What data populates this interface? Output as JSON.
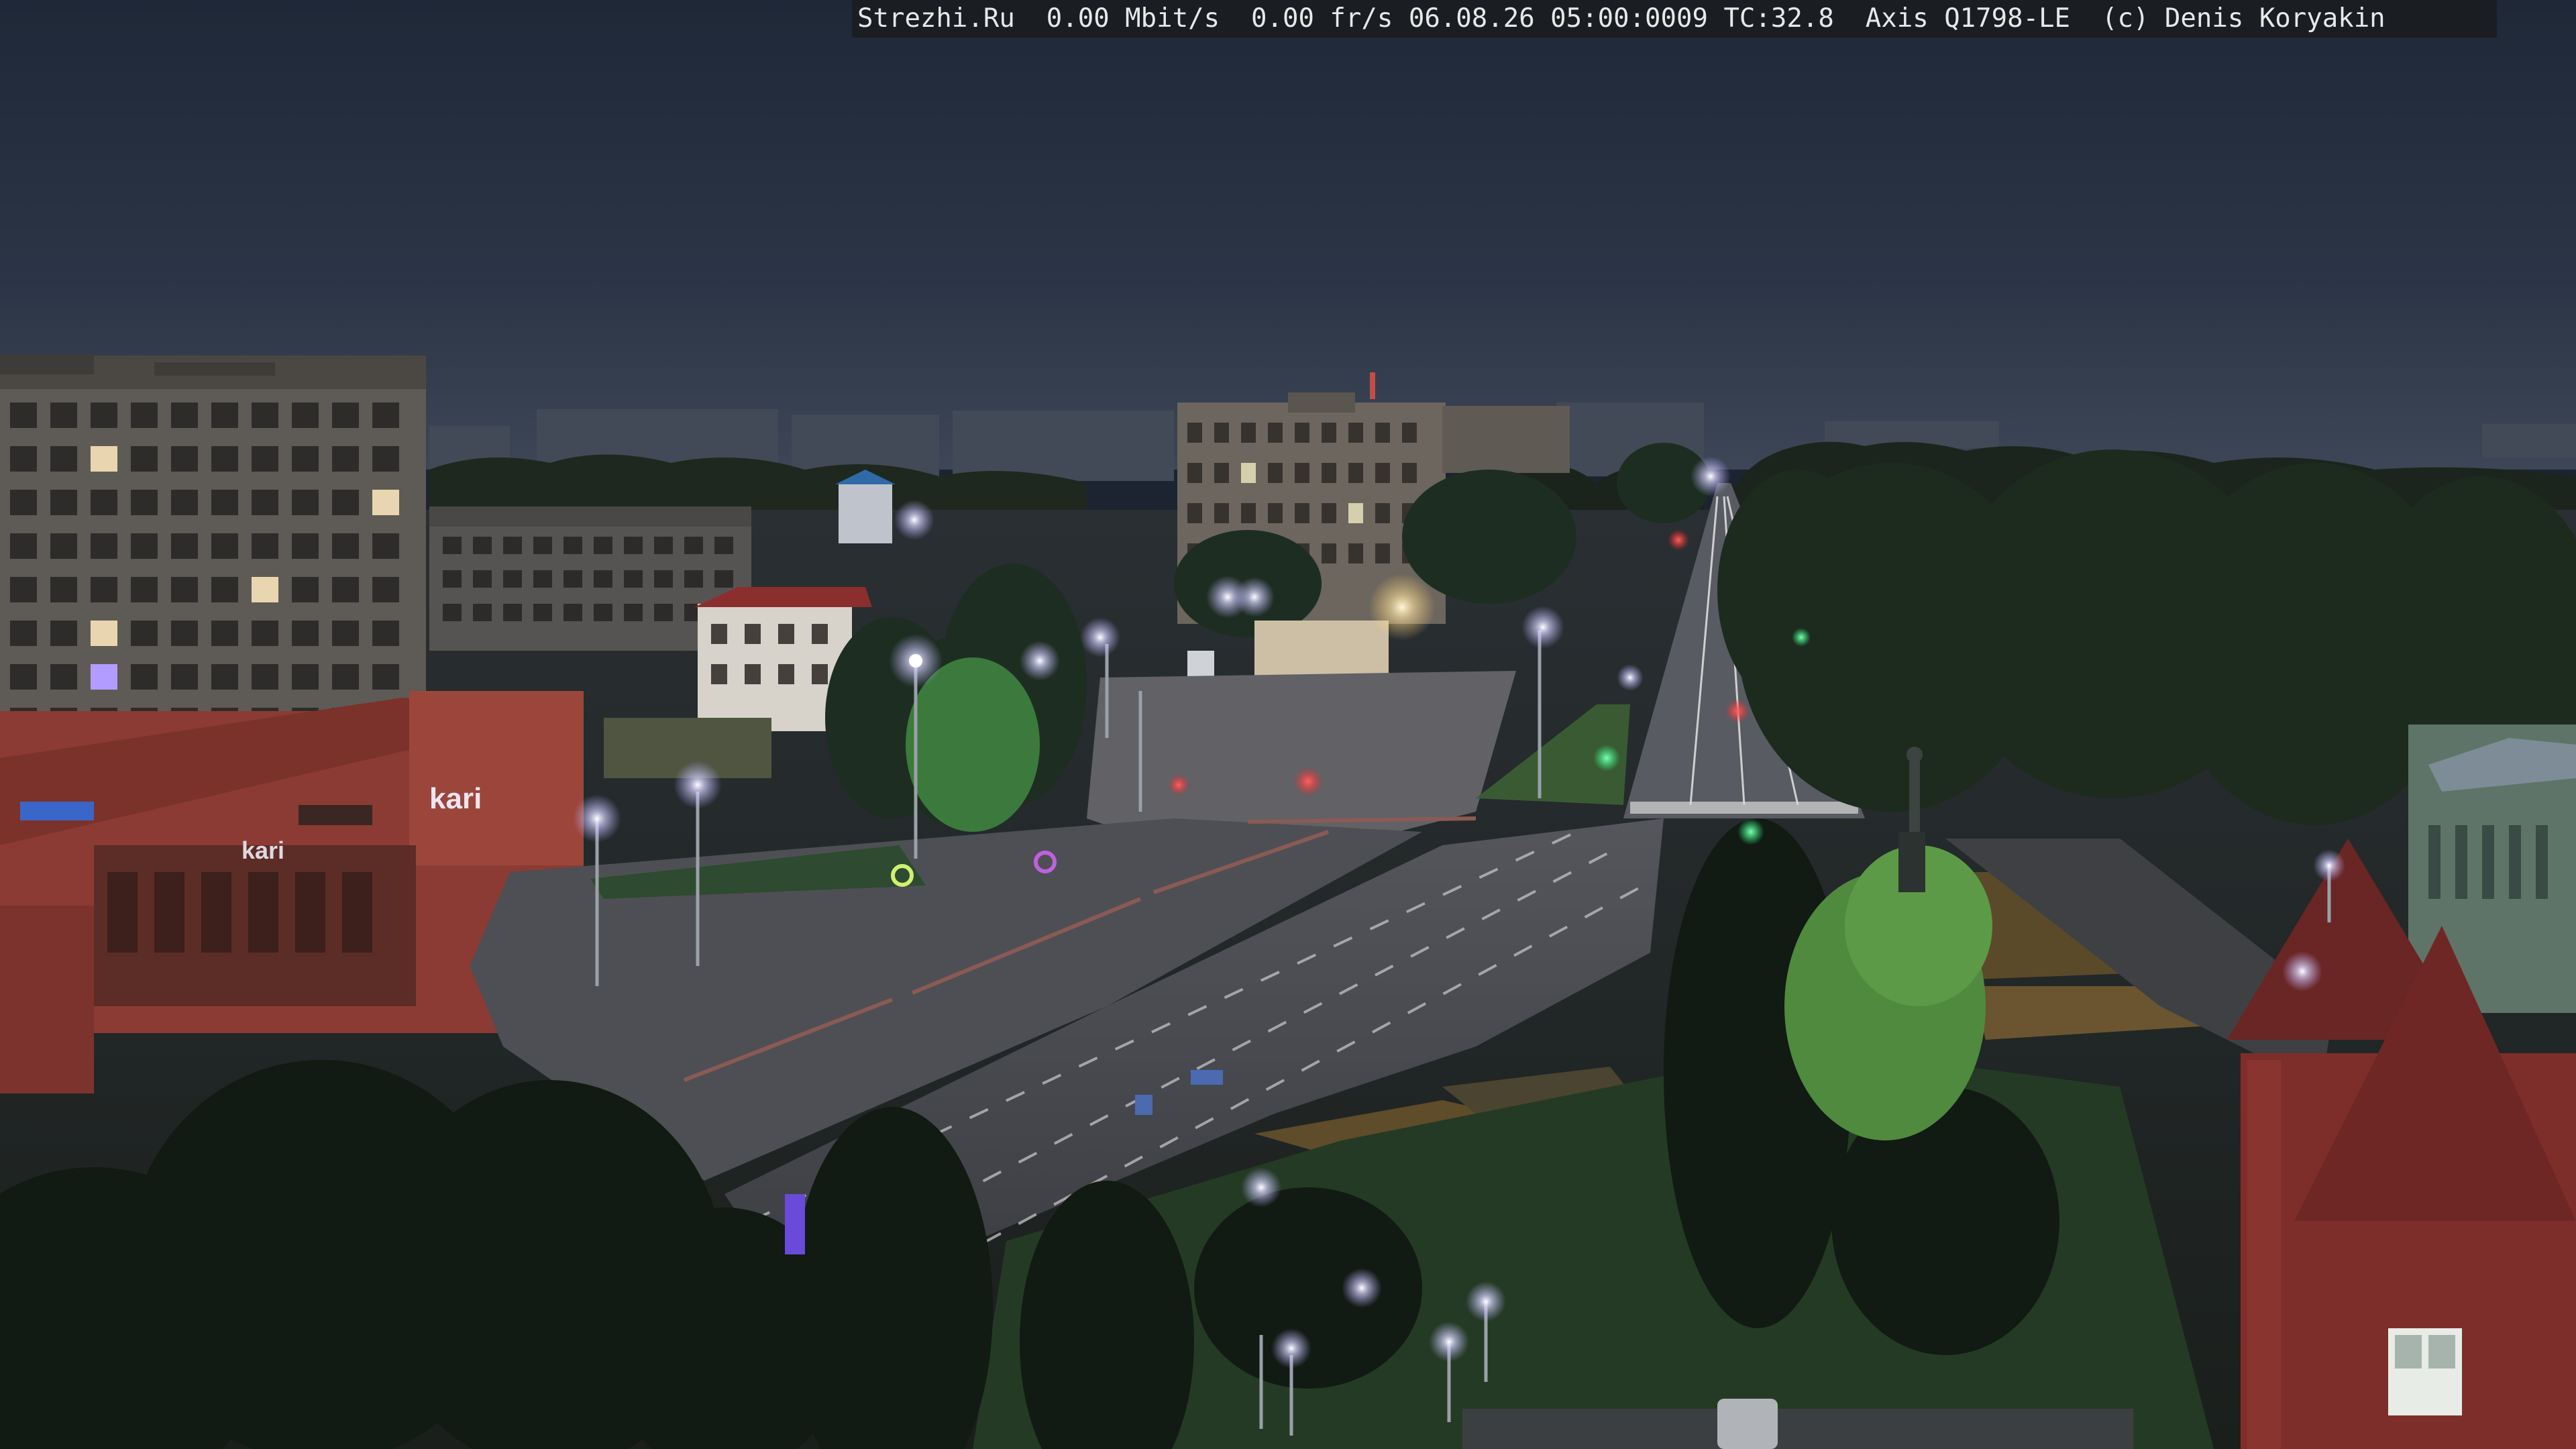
{
  "overlay": {
    "site": "Strezhi.Ru",
    "bitrate": "0.00 Mbit/s",
    "framerate": "0.00 fr/s",
    "datetime": "06.08.26 05:00:0009",
    "temperature": "TC:32.8",
    "camera_model": "Axis Q1798-LE",
    "copyright": "(c) Denis Koryakin"
  },
  "signs": {
    "store_sign": "kari",
    "store_sign_small": "kari"
  },
  "scene": {
    "description_colors": {
      "sky": "#253041",
      "sky_horizon": "#3a4658",
      "road": "#3c4048",
      "trees": "#1f2b1f",
      "street_light": "#e9e6ff",
      "building_brick": "#8a3a32",
      "panel_block": "#6b6760"
    }
  }
}
